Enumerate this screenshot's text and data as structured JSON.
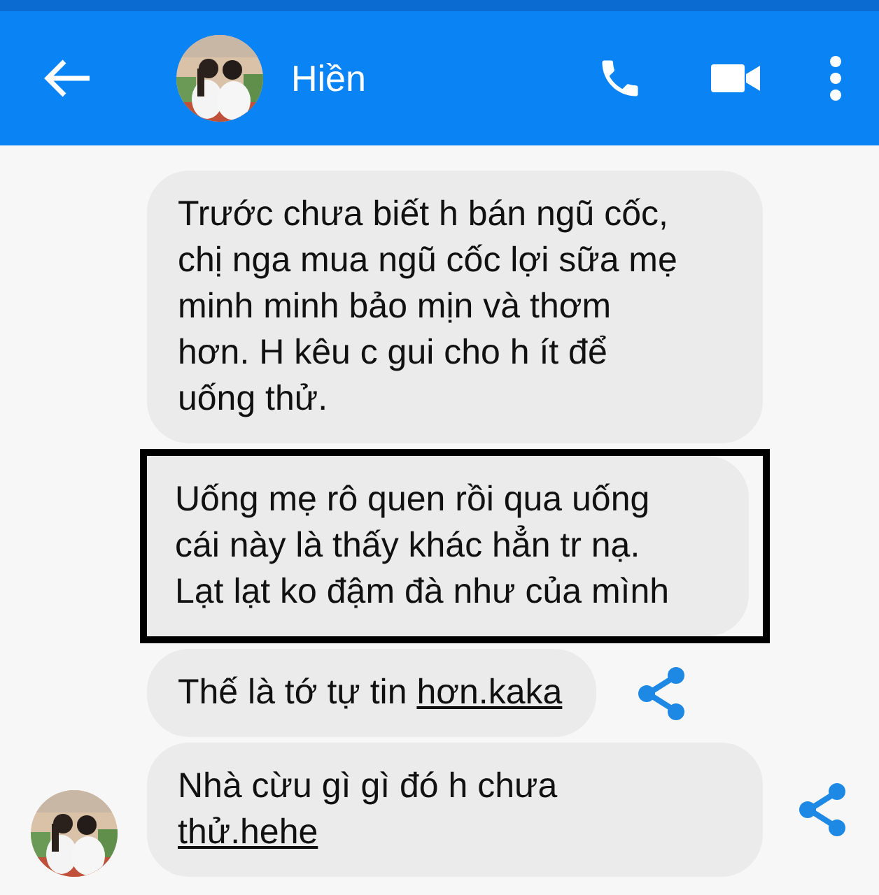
{
  "header": {
    "contact_name": "Hiền"
  },
  "messages": [
    {
      "segments": [
        {
          "text": "Trước chưa biết h bán ngũ cốc,\nchị nga mua ngũ cốc lợi sữa mẹ\nminh minh bảo mịn và thơm\nhơn. H kêu c gui cho h ít để\nuống thử.",
          "link": false
        }
      ],
      "highlighted": false,
      "shareable": false,
      "show_avatar": false
    },
    {
      "segments": [
        {
          "text": "Uống mẹ rô quen rồi qua uống\ncái này là thấy khác hẳn tr nạ.\nLạt lạt ko đậm đà như của mình",
          "link": false
        }
      ],
      "highlighted": true,
      "shareable": false,
      "show_avatar": false
    },
    {
      "segments": [
        {
          "text": "Thế là tớ tự tin ",
          "link": false
        },
        {
          "text": "hơn.kaka",
          "link": true
        }
      ],
      "highlighted": false,
      "shareable": true,
      "show_avatar": false
    },
    {
      "segments": [
        {
          "text": "Nhà cừu gì gì đó h chưa\n",
          "link": false
        },
        {
          "text": "thử.hehe",
          "link": true
        }
      ],
      "highlighted": false,
      "shareable": true,
      "show_avatar": true
    }
  ]
}
